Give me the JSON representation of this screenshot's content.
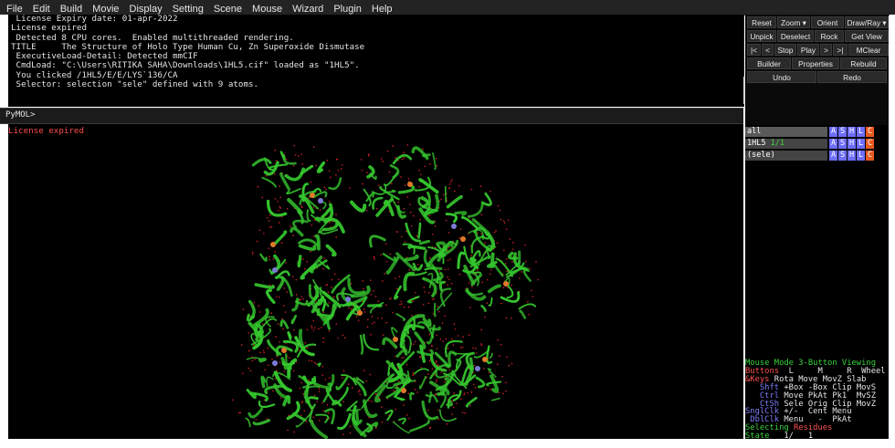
{
  "menu": [
    "File",
    "Edit",
    "Build",
    "Movie",
    "Display",
    "Setting",
    "Scene",
    "Mouse",
    "Wizard",
    "Plugin",
    "Help"
  ],
  "console": {
    "lines": [
      " License Expiry date: 01-apr-2022",
      "License expired",
      " Detected 8 CPU cores.  Enabled multithreaded rendering.",
      "TITLE     The Structure of Holo Type Human Cu, Zn Superoxide Dismutase",
      " ExecutiveLoad-Detail: Detected mmCIF",
      " CmdLoad: \"C:\\Users\\RITIKA SAHA\\Downloads\\1HL5.cif\" loaded as \"1HL5\".",
      " You clicked /1HL5/E/E/LYS`136/CA",
      " Selector: selection \"sele\" defined with 9 atoms."
    ]
  },
  "command": {
    "prompt": "PyMOL>",
    "value": ""
  },
  "viewer": {
    "warning": "License expired",
    "protein_color": "#35c72e",
    "background": "#000000"
  },
  "buttons": {
    "row1": [
      "Reset",
      "Zoom ▾",
      "Orient",
      "Draw/Ray ▾"
    ],
    "row2": [
      "Unpick",
      "Deselect",
      "Rock",
      "Get View"
    ],
    "row3": [
      "|<",
      "<",
      "Stop",
      "Play",
      ">",
      ">|",
      "MClear"
    ],
    "row4": [
      "Builder",
      "Properties",
      "Rebuild"
    ],
    "row5": [
      "Undo",
      "Redo"
    ]
  },
  "objects": [
    {
      "name": "all",
      "state": "",
      "letters": [
        "A",
        "S",
        "H",
        "L",
        "C"
      ]
    },
    {
      "name": "1HL5",
      "state": "1/1",
      "letters": [
        "A",
        "S",
        "H",
        "L",
        "C"
      ]
    },
    {
      "name": "(sele)",
      "state": "",
      "letters": [
        "A",
        "S",
        "H",
        "L",
        "C"
      ]
    }
  ],
  "mouse_mode": {
    "title": "Mouse Mode 3-Button Viewing",
    "buttons_label": "Buttons",
    "buttons": "  L     M     R  Wheel",
    "keys_label": " & Keys",
    "rows": [
      {
        "key": "&Keys",
        "vals": "Rota Move MovZ Slab"
      },
      {
        "key": "Shft",
        "vals": "+Box -Box Clip MovS"
      },
      {
        "key": "Ctrl",
        "vals": "Move PkAt Pk1  MvSZ"
      },
      {
        "key": "CtSh",
        "vals": "Sele Orig Clip MovZ"
      },
      {
        "key": "SnglClk",
        "vals": "+/-  Cent Menu"
      },
      {
        "key": "DblClk",
        "vals": "Menu   -  PkAt"
      }
    ],
    "selecting_label": "Selecting",
    "selecting_value": "Residues",
    "state_label": "State",
    "state_value": "1/   1"
  }
}
